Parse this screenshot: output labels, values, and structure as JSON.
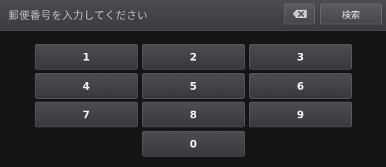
{
  "header": {
    "prompt": "郵便番号を入力してください",
    "backspace_icon": "backspace-icon",
    "search_label": "検索"
  },
  "keypad": {
    "keys": [
      "1",
      "2",
      "3",
      "4",
      "5",
      "6",
      "7",
      "8",
      "9",
      "0"
    ]
  }
}
